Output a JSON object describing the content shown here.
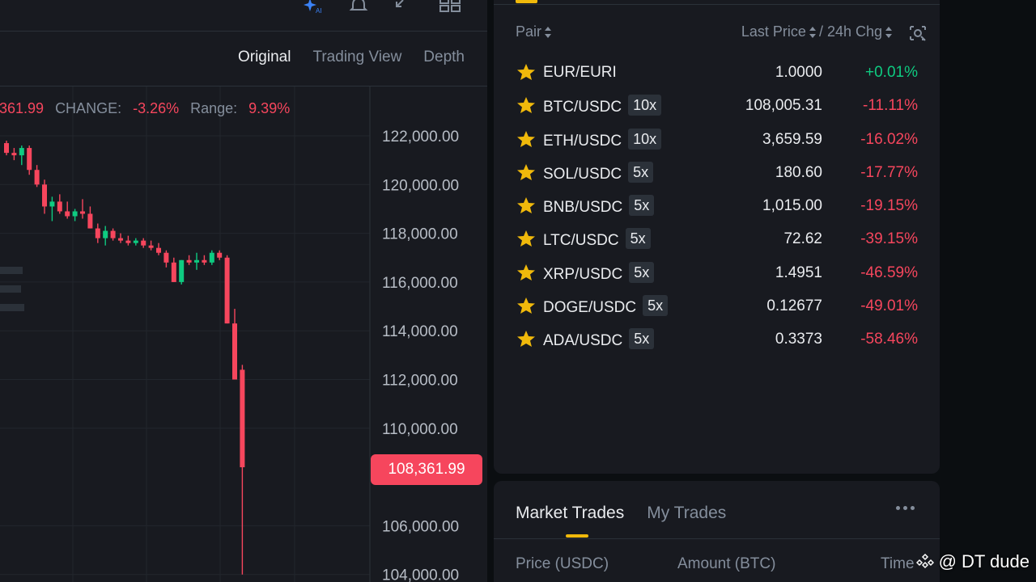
{
  "chart": {
    "tabs": [
      "Original",
      "Trading View",
      "Depth"
    ],
    "info": {
      "last_value": "361.99",
      "change_label": "CHANGE:",
      "change_value": "-3.26%",
      "range_label": "Range:",
      "range_value": "9.39%"
    },
    "current_price": "108,361.99",
    "colors": {
      "up": "#0ecb81",
      "down": "#f6465d",
      "accent": "#f0b90b"
    },
    "icons": [
      "ai-sparkle-icon",
      "bell-icon",
      "collapse-arrow-icon",
      "layout-grid-icon"
    ]
  },
  "chart_data": {
    "type": "candlestick",
    "y_ticks": [
      "122,000.00",
      "120,000.00",
      "118,000.00",
      "116,000.00",
      "114,000.00",
      "112,000.00",
      "110,000.00",
      "106,000.00",
      "104,000.00"
    ],
    "y_tick_values": [
      122000,
      120000,
      118000,
      116000,
      114000,
      112000,
      110000,
      106000,
      104000
    ],
    "ylim": [
      104000,
      124000
    ],
    "grid": true,
    "candles": [
      {
        "o": 121700,
        "h": 121800,
        "l": 121200,
        "c": 121300
      },
      {
        "o": 121300,
        "h": 121500,
        "l": 121000,
        "c": 121200
      },
      {
        "o": 121200,
        "h": 121600,
        "l": 120800,
        "c": 121500
      },
      {
        "o": 121500,
        "h": 121600,
        "l": 120400,
        "c": 120600
      },
      {
        "o": 120600,
        "h": 120800,
        "l": 119900,
        "c": 120000
      },
      {
        "o": 120000,
        "h": 120200,
        "l": 118800,
        "c": 119100
      },
      {
        "o": 119100,
        "h": 119500,
        "l": 118500,
        "c": 119300
      },
      {
        "o": 119300,
        "h": 119600,
        "l": 118800,
        "c": 118900
      },
      {
        "o": 118900,
        "h": 119300,
        "l": 118600,
        "c": 118700
      },
      {
        "o": 118700,
        "h": 119000,
        "l": 118500,
        "c": 118900
      },
      {
        "o": 118900,
        "h": 119400,
        "l": 118600,
        "c": 118800
      },
      {
        "o": 118800,
        "h": 119100,
        "l": 118200,
        "c": 118200
      },
      {
        "o": 118200,
        "h": 118400,
        "l": 117600,
        "c": 117800
      },
      {
        "o": 117800,
        "h": 118300,
        "l": 117500,
        "c": 118100
      },
      {
        "o": 118100,
        "h": 118200,
        "l": 117700,
        "c": 117800
      },
      {
        "o": 117800,
        "h": 118000,
        "l": 117600,
        "c": 117700
      },
      {
        "o": 117700,
        "h": 117900,
        "l": 117500,
        "c": 117600
      },
      {
        "o": 117600,
        "h": 117800,
        "l": 117500,
        "c": 117700
      },
      {
        "o": 117700,
        "h": 117800,
        "l": 117400,
        "c": 117500
      },
      {
        "o": 117500,
        "h": 117700,
        "l": 117300,
        "c": 117400
      },
      {
        "o": 117400,
        "h": 117600,
        "l": 117100,
        "c": 117200
      },
      {
        "o": 117200,
        "h": 117300,
        "l": 116600,
        "c": 116800
      },
      {
        "o": 116800,
        "h": 117000,
        "l": 116000,
        "c": 116000
      },
      {
        "o": 116000,
        "h": 116900,
        "l": 115900,
        "c": 116900
      },
      {
        "o": 116900,
        "h": 117100,
        "l": 116700,
        "c": 116800
      },
      {
        "o": 116800,
        "h": 117200,
        "l": 116500,
        "c": 116900
      },
      {
        "o": 116900,
        "h": 117100,
        "l": 116700,
        "c": 116800
      },
      {
        "o": 116800,
        "h": 117300,
        "l": 116700,
        "c": 117200
      },
      {
        "o": 117200,
        "h": 117300,
        "l": 116900,
        "c": 117000
      },
      {
        "o": 117000,
        "h": 117100,
        "l": 114300,
        "c": 114300
      },
      {
        "o": 114300,
        "h": 114900,
        "l": 112000,
        "c": 112000
      },
      {
        "o": 112400,
        "h": 112600,
        "l": 104000,
        "c": 108400
      }
    ]
  },
  "market": {
    "headers": {
      "pair": "Pair",
      "last_price": "Last Price",
      "change": "/ 24h Chg"
    },
    "pairs": [
      {
        "pair": "EUR/EURI",
        "leverage": "",
        "price": "1.0000",
        "change": "+0.01%",
        "dir": "up"
      },
      {
        "pair": "BTC/USDC",
        "leverage": "10x",
        "price": "108,005.31",
        "change": "-11.11%",
        "dir": "down"
      },
      {
        "pair": "ETH/USDC",
        "leverage": "10x",
        "price": "3,659.59",
        "change": "-16.02%",
        "dir": "down"
      },
      {
        "pair": "SOL/USDC",
        "leverage": "5x",
        "price": "180.60",
        "change": "-17.77%",
        "dir": "down"
      },
      {
        "pair": "BNB/USDC",
        "leverage": "5x",
        "price": "1,015.00",
        "change": "-19.15%",
        "dir": "down"
      },
      {
        "pair": "LTC/USDC",
        "leverage": "5x",
        "price": "72.62",
        "change": "-39.15%",
        "dir": "down"
      },
      {
        "pair": "XRP/USDC",
        "leverage": "5x",
        "price": "1.4951",
        "change": "-46.59%",
        "dir": "down"
      },
      {
        "pair": "DOGE/USDC",
        "leverage": "5x",
        "price": "0.12677",
        "change": "-49.01%",
        "dir": "down"
      },
      {
        "pair": "ADA/USDC",
        "leverage": "5x",
        "price": "0.3373",
        "change": "-58.46%",
        "dir": "down"
      }
    ]
  },
  "trades": {
    "tabs": [
      "Market Trades",
      "My Trades"
    ],
    "columns": [
      "Price (USDC)",
      "Amount (BTC)",
      "Time"
    ]
  },
  "watermark": {
    "text": "@ DT dude"
  }
}
